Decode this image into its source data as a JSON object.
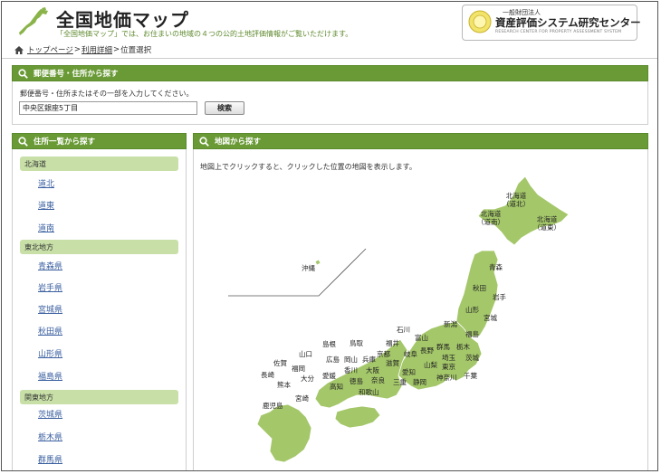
{
  "header": {
    "title": "全国地価マップ",
    "tagline": "「全国地価マップ」では、お住まいの地域の４つの公的土地評価情報がご覧いただけます。",
    "org_small": "一般財団法人",
    "org_name": "資産評価システム研究センター",
    "org_en": "RESEARCH CENTER FOR PROPERTY ASSESSMENT SYSTEM"
  },
  "breadcrumb": {
    "items": [
      "トップページ",
      "利用詳細"
    ],
    "current": "位置選択",
    "separator": ">"
  },
  "search": {
    "title": "郵便番号・住所から探す",
    "description": "郵便番号・住所またはその一部を入力してください。",
    "input_value": "中央区銀座5丁目",
    "button_label": "検索"
  },
  "address_list": {
    "title": "住所一覧から探す",
    "regions": [
      {
        "name": "北海道",
        "prefectures": [
          "道北",
          "道東",
          "道南"
        ]
      },
      {
        "name": "東北地方",
        "prefectures": [
          "青森県",
          "岩手県",
          "宮城県",
          "秋田県",
          "山形県",
          "福島県"
        ]
      },
      {
        "name": "関東地方",
        "prefectures": [
          "茨城県",
          "栃木県",
          "群馬県"
        ]
      }
    ]
  },
  "map": {
    "title": "地図から探す",
    "description": "地図上でクリックすると、クリックした位置の地図を表示します。",
    "land_color": "#a4c76a",
    "labels": {
      "doboku": "北海道\n（道北）",
      "donan": "北海道\n（道南）",
      "doto": "北海道\n（道東）",
      "okinawa": "沖縄",
      "aomori": "青森",
      "akita": "秋田",
      "iwate": "岩手",
      "yamagata": "山形",
      "miyagi": "宮城",
      "ishikawa": "石川",
      "niigata": "新潟",
      "toyama": "富山",
      "fukushima": "福島",
      "fukui": "福井",
      "nagano": "長野",
      "gunma": "群馬",
      "tochigi": "栃木",
      "tottori": "鳥取",
      "shimane": "島根",
      "kyoto": "京都",
      "gifu": "岐阜",
      "saitama": "埼玉",
      "ibaraki": "茨城",
      "yamaguchi": "山口",
      "hiroshima": "広島",
      "okayama": "岡山",
      "hyogo": "兵庫",
      "shiga": "滋賀",
      "aichi": "愛知",
      "yamanashi": "山梨",
      "tokyo": "東京",
      "saga": "佐賀",
      "fukuoka": "福岡",
      "kagawa": "香川",
      "osaka": "大阪",
      "nara": "奈良",
      "mie": "三重",
      "shizuoka": "静岡",
      "kanagawa": "神奈川",
      "chiba": "千葉",
      "nagasaki": "長崎",
      "ehime": "愛媛",
      "tokushima": "徳島",
      "kumamoto": "熊本",
      "oita": "大分",
      "kochi": "高知",
      "wakayama": "和歌山",
      "miyazaki": "宮崎",
      "kagoshima": "鹿児島"
    }
  }
}
